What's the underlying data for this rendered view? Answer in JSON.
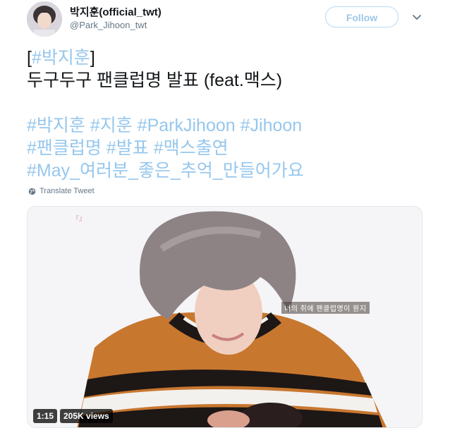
{
  "tweet": {
    "author": {
      "name": "박지훈(official_twt)",
      "handle": "@Park_Jihoon_twt"
    },
    "follow_label": "Follow",
    "lines": [
      [
        {
          "text": "[",
          "tag": false
        },
        {
          "text": "#박지훈",
          "tag": true
        },
        {
          "text": "]",
          "tag": false
        }
      ],
      [
        {
          "text": "두구두구 팬클럽명 발표 (feat.맥스)",
          "tag": false
        }
      ],
      [],
      [
        {
          "text": "#박지훈 #지훈 #ParkJihoon #Jihoon",
          "tag": true
        }
      ],
      [
        {
          "text": "#팬클럽명 #발표 #맥스출연",
          "tag": true
        }
      ],
      [
        {
          "text": "#May_여러분_좋은_추억_만들어가요",
          "tag": true
        }
      ]
    ],
    "translate_label": "Translate Tweet",
    "video": {
      "corner_mark": "『』",
      "caption": "너의 취에 팬클럽명이 뭔지",
      "duration": "1:15",
      "views": "205K views"
    }
  },
  "icons": {
    "menu": "chevron-down-icon",
    "translate": "globe-icon"
  },
  "colors": {
    "hashtag": "#96c7ed",
    "follow_border": "#b7d8f3",
    "follow_text": "#9cc8ea",
    "secondary_text": "#657786"
  }
}
